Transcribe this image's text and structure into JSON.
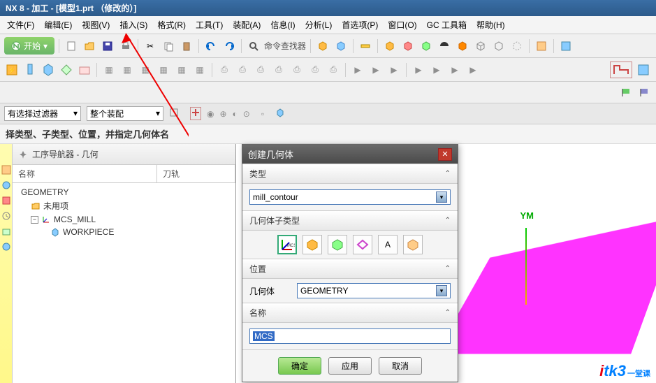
{
  "title": "NX 8 - 加工 - [模型1.prt （修改的）]",
  "menubar": {
    "file": "文件(F)",
    "edit": "编辑(E)",
    "view": "视图(V)",
    "insert": "插入(S)",
    "format": "格式(R)",
    "tool": "工具(T)",
    "assembly": "装配(A)",
    "info": "信息(I)",
    "analysis": "分析(L)",
    "pref": "首选项(P)",
    "window": "窗口(O)",
    "gc": "GC 工具箱",
    "help": "帮助(H)"
  },
  "toolbar": {
    "start": "开始",
    "cmd_finder": "命令查找器"
  },
  "filter": {
    "no_filter": "有选择过滤器",
    "assembly": "整个装配"
  },
  "hint": "择类型、子类型、位置，并指定几何体名",
  "nav": {
    "title": "工序导航器 - 几何",
    "col_name": "名称",
    "col_tool": "刀轨",
    "items": {
      "geometry": "GEOMETRY",
      "unused": "未用项",
      "mcs": "MCS_MILL",
      "workpiece": "WORKPIECE"
    }
  },
  "dialog": {
    "title": "创建几何体",
    "type_label": "类型",
    "type_value": "mill_contour",
    "subtype_label": "几何体子类型",
    "position_label": "位置",
    "geom_label": "几何体",
    "geom_value": "GEOMETRY",
    "name_label": "名称",
    "name_value": "MCS",
    "ok": "确定",
    "apply": "应用",
    "cancel": "取消"
  },
  "axes": {
    "ym": "YM"
  },
  "watermark": {
    "brand_i": "i",
    "brand_tk3": "tk3",
    "cn": "一堂课"
  }
}
